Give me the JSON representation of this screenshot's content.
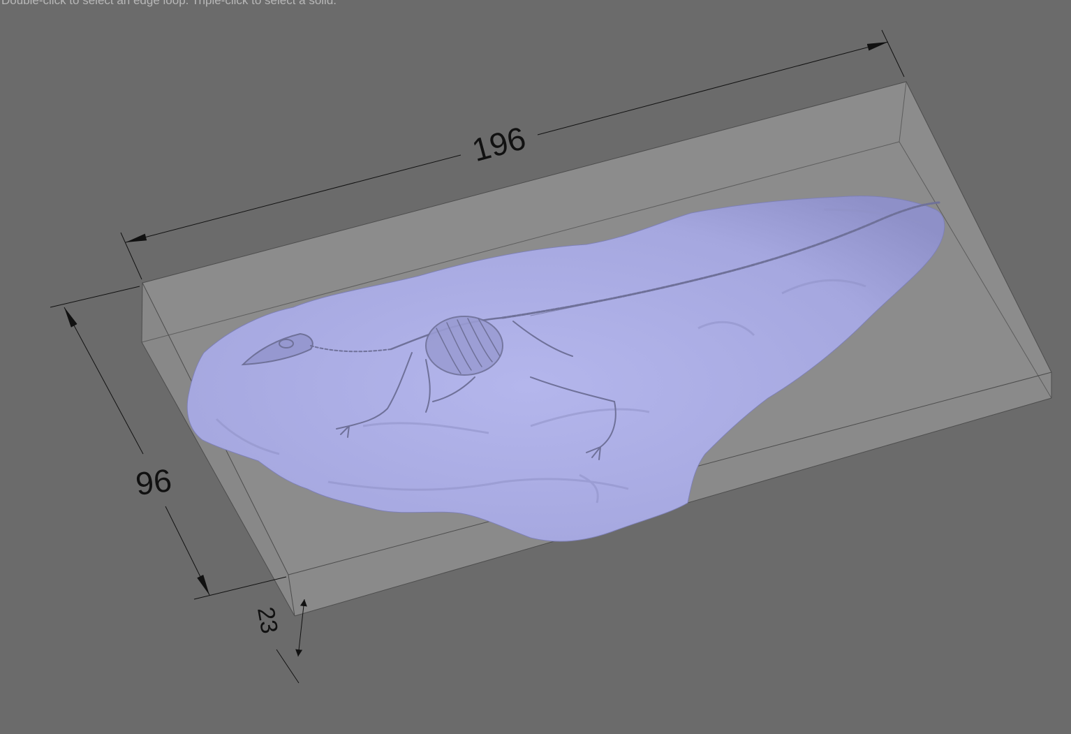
{
  "viewport": {
    "hint_text": "Double-click to select an edge loop. Triple-click to select a solid.",
    "background_color": "#6b6b6b"
  },
  "model": {
    "fill_color": "#a9abe3",
    "box_fill_color": "#8c8c8c"
  },
  "dimensions": {
    "length": "196",
    "width": "96",
    "height": "23"
  }
}
